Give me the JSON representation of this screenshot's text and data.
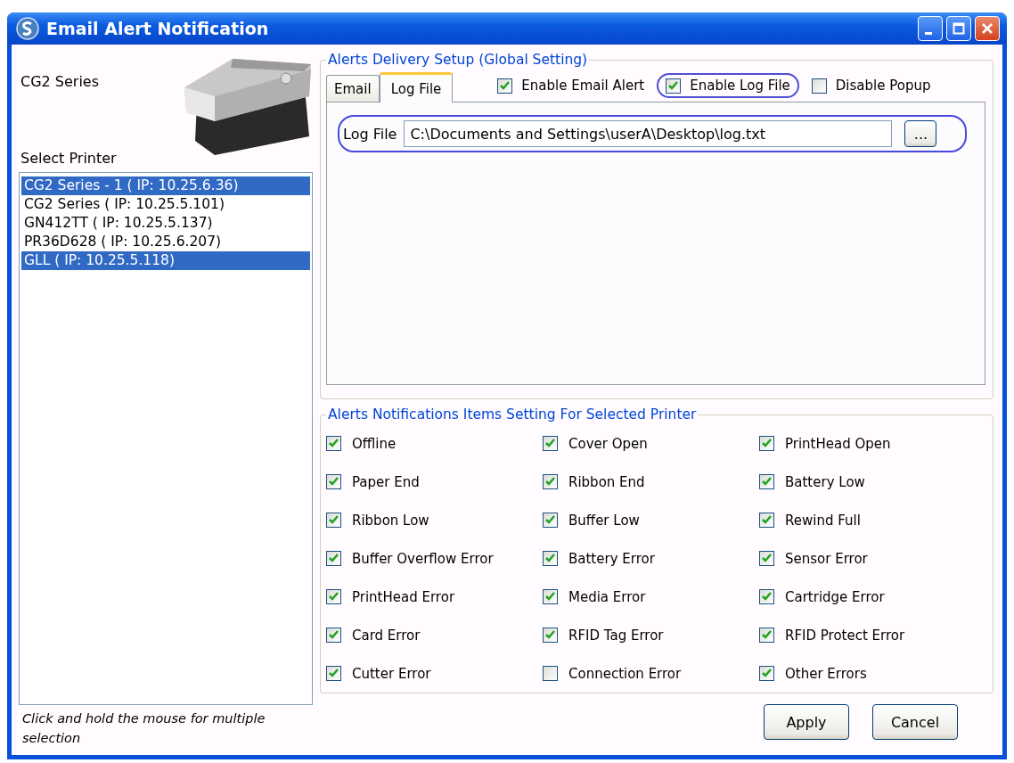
{
  "window": {
    "title": "Email Alert Notification"
  },
  "printer_panel": {
    "model_label": "CG2 Series",
    "select_label": "Select Printer",
    "printers": [
      {
        "label": "CG2 Series - 1 ( IP: 10.25.6.36)",
        "selected": true
      },
      {
        "label": "CG2 Series ( IP: 10.25.5.101)",
        "selected": false
      },
      {
        "label": "GN412TT ( IP: 10.25.5.137)",
        "selected": false
      },
      {
        "label": "PR36D628 ( IP: 10.25.6.207)",
        "selected": false
      },
      {
        "label": "GLL ( IP: 10.25.5.118)",
        "selected": true
      }
    ],
    "hint": "Click and hold the mouse for multiple selection"
  },
  "delivery_setup": {
    "title": "Alerts Delivery Setup (Global Setting)",
    "tabs": [
      {
        "label": "Email",
        "selected": false
      },
      {
        "label": "Log File",
        "selected": true
      }
    ],
    "options": [
      {
        "label": "Enable Email Alert",
        "checked": true,
        "highlighted": false
      },
      {
        "label": "Enable Log File",
        "checked": true,
        "highlighted": true
      },
      {
        "label": "Disable Popup",
        "checked": false,
        "highlighted": false
      }
    ],
    "log_file": {
      "label": "Log File",
      "value": "C:\\Documents and Settings\\userA\\Desktop\\log.txt",
      "browse_button": "...",
      "highlighted": true
    }
  },
  "notification_items": {
    "title": "Alerts Notifications Items Setting For Selected Printer",
    "items": [
      {
        "label": "Offline",
        "checked": true
      },
      {
        "label": "Cover Open",
        "checked": true
      },
      {
        "label": "PrintHead Open",
        "checked": true
      },
      {
        "label": "Paper End",
        "checked": true
      },
      {
        "label": "Ribbon End",
        "checked": true
      },
      {
        "label": "Battery Low",
        "checked": true
      },
      {
        "label": "Ribbon Low",
        "checked": true
      },
      {
        "label": "Buffer Low",
        "checked": true
      },
      {
        "label": "Rewind Full",
        "checked": true
      },
      {
        "label": "Buffer Overflow Error",
        "checked": true
      },
      {
        "label": "Battery Error",
        "checked": true
      },
      {
        "label": "Sensor Error",
        "checked": true
      },
      {
        "label": "PrintHead Error",
        "checked": true
      },
      {
        "label": "Media Error",
        "checked": true
      },
      {
        "label": "Cartridge Error",
        "checked": true
      },
      {
        "label": "Card Error",
        "checked": true
      },
      {
        "label": "RFID Tag Error",
        "checked": true
      },
      {
        "label": "RFID Protect Error",
        "checked": true
      },
      {
        "label": "Cutter Error",
        "checked": true
      },
      {
        "label": "Connection Error",
        "checked": false
      },
      {
        "label": "Other Errors",
        "checked": true
      }
    ]
  },
  "buttons": [
    "Apply",
    "Cancel"
  ]
}
